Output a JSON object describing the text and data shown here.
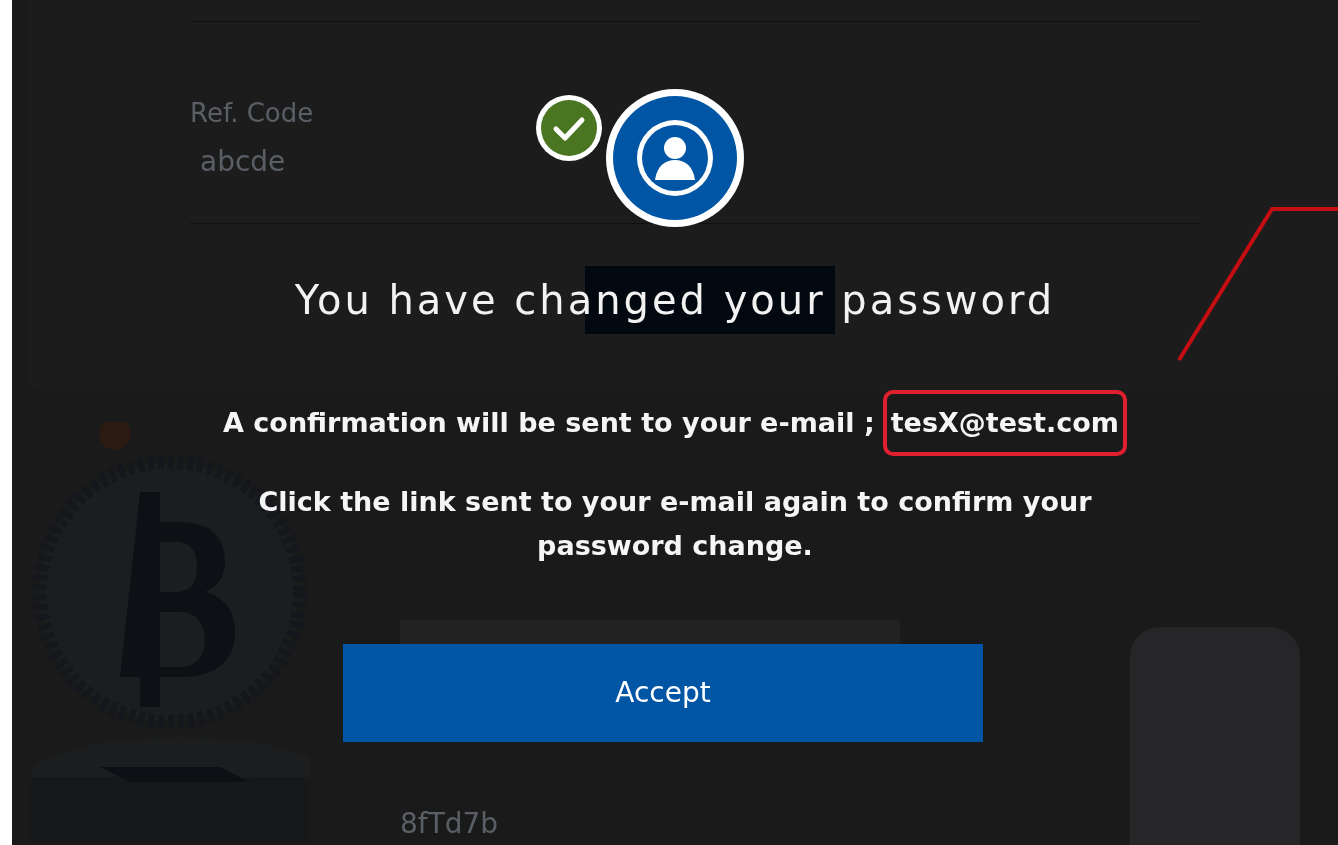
{
  "background_form": {
    "ref_code_label": "Ref. Code",
    "ref_code_value": "abcde",
    "captcha_value": "8fTd7b"
  },
  "dialog": {
    "title": "You have changed your password",
    "confirmation": "A confirmation will be sent to your e-mail ;",
    "email": "tesX@test.com",
    "instruction": "Click the link sent to your e-mail again to confirm your password change.",
    "button": "Accept"
  }
}
